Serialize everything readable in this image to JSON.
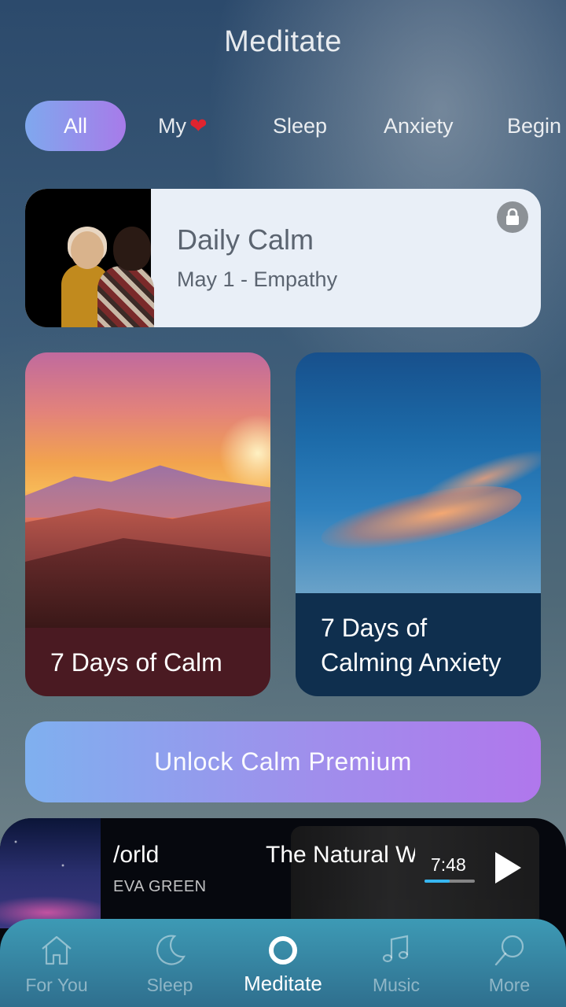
{
  "header": {
    "title": "Meditate"
  },
  "categories": [
    {
      "label": "All",
      "active": true
    },
    {
      "label": "My",
      "icon": "heart-icon"
    },
    {
      "label": "Sleep"
    },
    {
      "label": "Anxiety"
    },
    {
      "label": "Begin"
    }
  ],
  "daily_calm": {
    "title": "Daily Calm",
    "subtitle": "May 1 - Empathy",
    "icon": "lock-icon"
  },
  "programs": [
    {
      "title": "7 Days of Calm"
    },
    {
      "title_line1": "7 Days of",
      "title_line2": "Calming Anxiety"
    }
  ],
  "premium": {
    "label": "Unlock Calm Premium"
  },
  "now_playing": {
    "track_partial": "/orld",
    "artist": "EVA GREEN",
    "next_track_partial": "The Natural W",
    "time": "7:48",
    "progress": 0.5
  },
  "tabbar": {
    "items": [
      {
        "label": "For You",
        "icon": "home-icon"
      },
      {
        "label": "Sleep",
        "icon": "moon-icon"
      },
      {
        "label": "Meditate",
        "icon": "circle-icon",
        "active": true
      },
      {
        "label": "Music",
        "icon": "music-note-icon"
      },
      {
        "label": "More",
        "icon": "search-icon"
      }
    ]
  },
  "colors": {
    "chip_gradient_start": "#7fa8ee",
    "chip_gradient_end": "#a77be9",
    "heart": "#e0242f",
    "progress": "#37b6f0",
    "tabbar": "#3d9ab5"
  }
}
